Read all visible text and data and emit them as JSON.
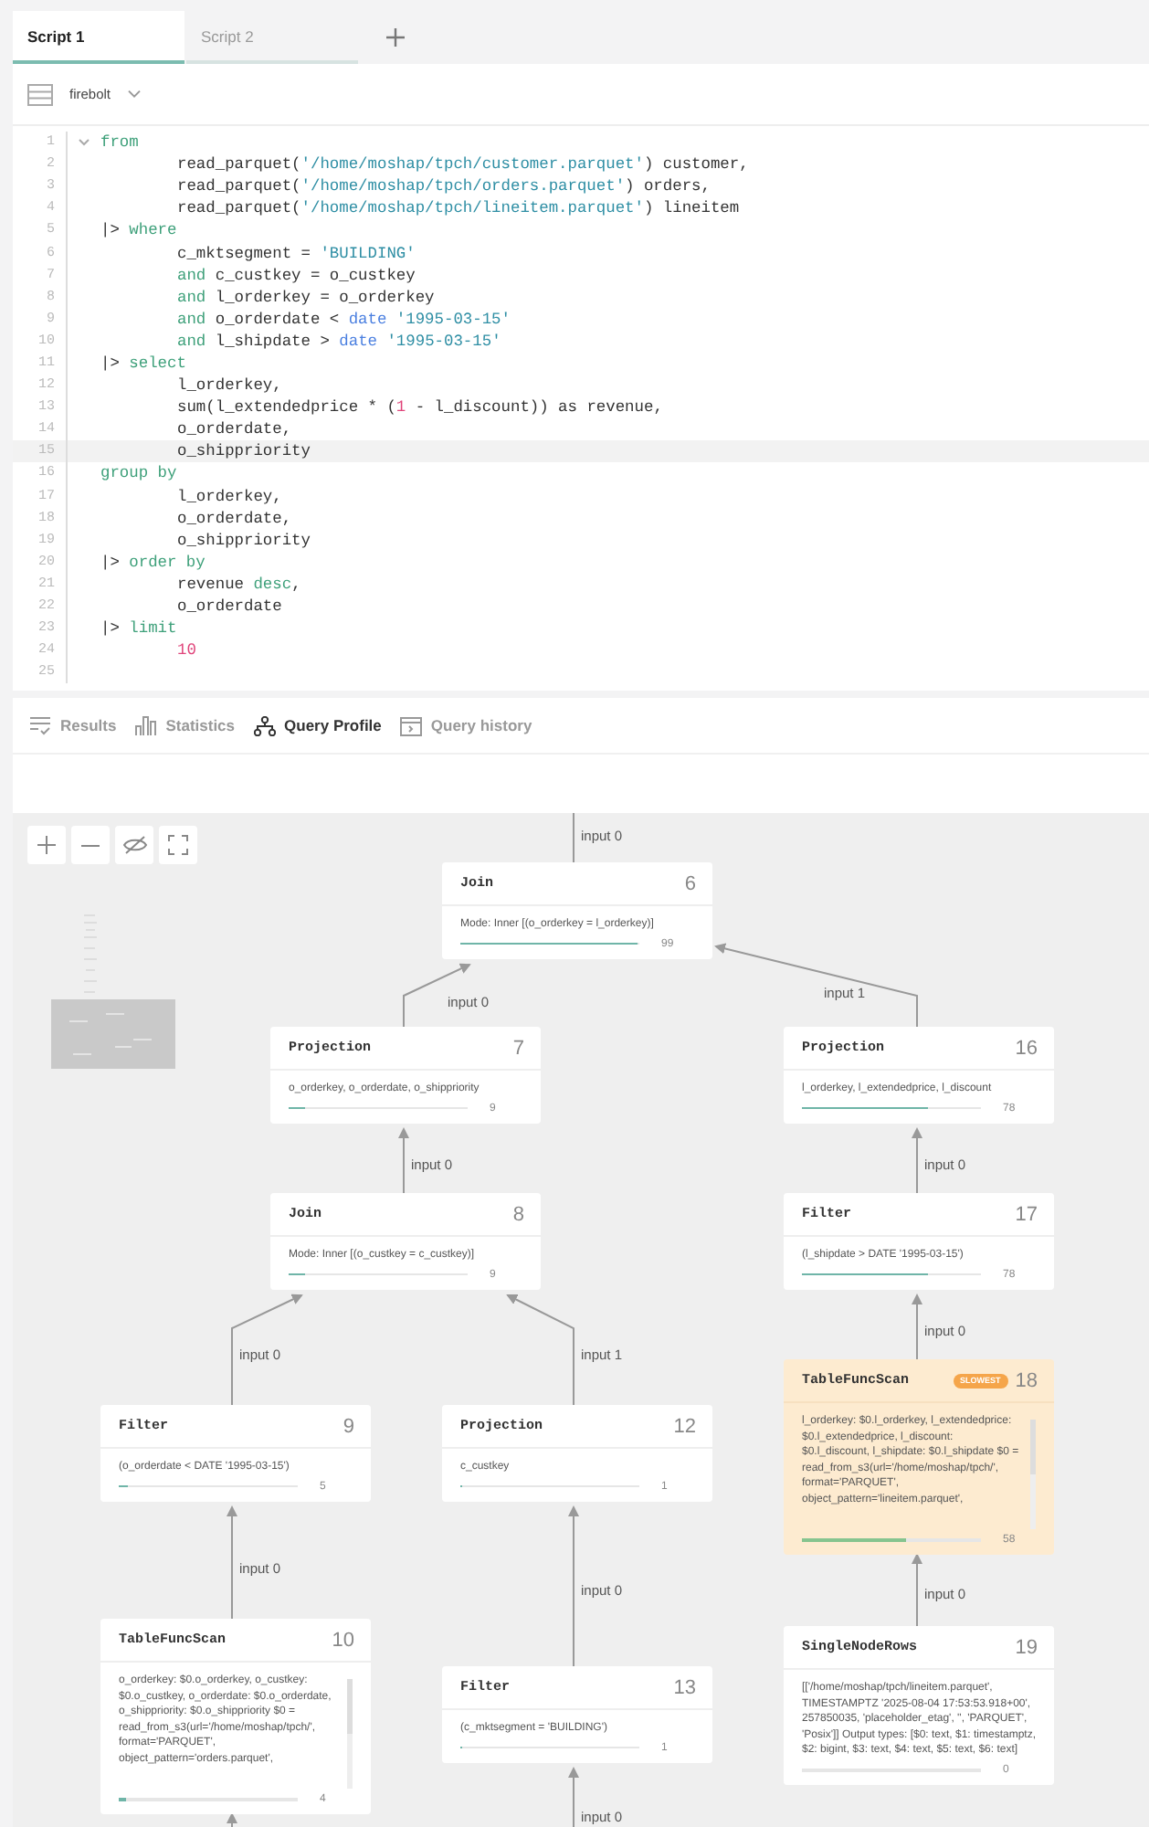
{
  "script_tabs": [
    {
      "label": "Script 1",
      "selected": true
    },
    {
      "label": "Script 2",
      "selected": false
    }
  ],
  "database": {
    "name": "firebolt"
  },
  "editor": {
    "lines": [
      {
        "number": "1",
        "indent": false,
        "highlighted": false,
        "tokens": [
          {
            "kind": "kw",
            "t": "from"
          }
        ]
      },
      {
        "number": "2",
        "indent": true,
        "highlighted": false,
        "tokens": [
          {
            "kind": "plain",
            "t": "read_parquet("
          },
          {
            "kind": "str",
            "t": "'/home/moshap/tpch/customer.parquet'"
          },
          {
            "kind": "plain",
            "t": ") customer,"
          }
        ]
      },
      {
        "number": "3",
        "indent": true,
        "highlighted": false,
        "tokens": [
          {
            "kind": "plain",
            "t": "read_parquet("
          },
          {
            "kind": "str",
            "t": "'/home/moshap/tpch/orders.parquet'"
          },
          {
            "kind": "plain",
            "t": ") orders,"
          }
        ]
      },
      {
        "number": "4",
        "indent": true,
        "highlighted": false,
        "tokens": [
          {
            "kind": "plain",
            "t": "read_parquet("
          },
          {
            "kind": "str",
            "t": "'/home/moshap/tpch/lineitem.parquet'"
          },
          {
            "kind": "plain",
            "t": ") lineitem"
          }
        ]
      },
      {
        "number": "5",
        "indent": false,
        "highlighted": false,
        "tokens": [
          {
            "kind": "plain",
            "t": "|> "
          },
          {
            "kind": "kw",
            "t": "where"
          }
        ]
      },
      {
        "number": "6",
        "indent": true,
        "highlighted": false,
        "tokens": [
          {
            "kind": "plain",
            "t": "c_mktsegment = "
          },
          {
            "kind": "str",
            "t": "'BUILDING'"
          }
        ]
      },
      {
        "number": "7",
        "indent": true,
        "highlighted": false,
        "tokens": [
          {
            "kind": "kw",
            "t": "and"
          },
          {
            "kind": "plain",
            "t": " c_custkey = o_custkey"
          }
        ]
      },
      {
        "number": "8",
        "indent": true,
        "highlighted": false,
        "tokens": [
          {
            "kind": "kw",
            "t": "and"
          },
          {
            "kind": "plain",
            "t": " l_orderkey = o_orderkey"
          }
        ]
      },
      {
        "number": "9",
        "indent": true,
        "highlighted": false,
        "tokens": [
          {
            "kind": "kw",
            "t": "and"
          },
          {
            "kind": "plain",
            "t": " o_orderdate < "
          },
          {
            "kind": "fn",
            "t": "date "
          },
          {
            "kind": "str",
            "t": "'1995-03-15'"
          }
        ]
      },
      {
        "number": "10",
        "indent": true,
        "highlighted": false,
        "tokens": [
          {
            "kind": "kw",
            "t": "and"
          },
          {
            "kind": "plain",
            "t": " l_shipdate > "
          },
          {
            "kind": "fn",
            "t": "date "
          },
          {
            "kind": "str",
            "t": "'1995-03-15'"
          }
        ]
      },
      {
        "number": "11",
        "indent": false,
        "highlighted": false,
        "tokens": [
          {
            "kind": "plain",
            "t": "|> "
          },
          {
            "kind": "kw",
            "t": "select"
          }
        ]
      },
      {
        "number": "12",
        "indent": true,
        "highlighted": false,
        "tokens": [
          {
            "kind": "plain",
            "t": "l_orderkey,"
          }
        ]
      },
      {
        "number": "13",
        "indent": true,
        "highlighted": false,
        "tokens": [
          {
            "kind": "plain",
            "t": "sum(l_extendedprice * ("
          },
          {
            "kind": "num",
            "t": "1"
          },
          {
            "kind": "plain",
            "t": " - l_discount)) as revenue,"
          }
        ]
      },
      {
        "number": "14",
        "indent": true,
        "highlighted": false,
        "tokens": [
          {
            "kind": "plain",
            "t": "o_orderdate,"
          }
        ]
      },
      {
        "number": "15",
        "indent": true,
        "highlighted": true,
        "tokens": [
          {
            "kind": "plain",
            "t": "o_shippriority"
          }
        ]
      },
      {
        "number": "16",
        "indent": false,
        "highlighted": false,
        "tokens": [
          {
            "kind": "kw",
            "t": "group by"
          }
        ]
      },
      {
        "number": "17",
        "indent": true,
        "highlighted": false,
        "tokens": [
          {
            "kind": "plain",
            "t": "l_orderkey,"
          }
        ]
      },
      {
        "number": "18",
        "indent": true,
        "highlighted": false,
        "tokens": [
          {
            "kind": "plain",
            "t": "o_orderdate,"
          }
        ]
      },
      {
        "number": "19",
        "indent": true,
        "highlighted": false,
        "tokens": [
          {
            "kind": "plain",
            "t": "o_shippriority"
          }
        ]
      },
      {
        "number": "20",
        "indent": false,
        "highlighted": false,
        "tokens": [
          {
            "kind": "plain",
            "t": "|> "
          },
          {
            "kind": "kw",
            "t": "order by"
          }
        ]
      },
      {
        "number": "21",
        "indent": true,
        "highlighted": false,
        "tokens": [
          {
            "kind": "plain",
            "t": "revenue "
          },
          {
            "kind": "kw",
            "t": "desc"
          },
          {
            "kind": "plain",
            "t": ","
          }
        ]
      },
      {
        "number": "22",
        "indent": true,
        "highlighted": false,
        "tokens": [
          {
            "kind": "plain",
            "t": "o_orderdate"
          }
        ]
      },
      {
        "number": "23",
        "indent": false,
        "highlighted": false,
        "tokens": [
          {
            "kind": "plain",
            "t": "|> "
          },
          {
            "kind": "kw",
            "t": "limit"
          }
        ]
      },
      {
        "number": "24",
        "indent": true,
        "highlighted": false,
        "tokens": [
          {
            "kind": "num",
            "t": "10"
          }
        ]
      },
      {
        "number": "25",
        "highlighted": false
      }
    ]
  },
  "result_tabs": [
    {
      "label": "Results",
      "kind": "results",
      "selected": false
    },
    {
      "label": "Statistics",
      "kind": "statistics",
      "selected": false
    },
    {
      "label": "Query Profile",
      "kind": "profile",
      "selected": true
    },
    {
      "label": "Query history",
      "kind": "history",
      "selected": false
    }
  ],
  "profile": {
    "nodes": [
      {
        "kind": "step",
        "title": "Join",
        "number": "6",
        "detail": "Mode: Inner [(o_orderkey = l_orderkey)]",
        "count": "99",
        "level": 0.99,
        "slowest": false
      },
      {
        "kind": "step",
        "title": "Projection",
        "number": "7",
        "detail": "o_orderkey, o_orderdate, o_shippriority",
        "count": "9",
        "level": 0.09,
        "slowest": false
      },
      {
        "kind": "step",
        "title": "Projection",
        "number": "16",
        "detail": "l_orderkey, l_extendedprice, l_discount",
        "count": "78",
        "level": 0.7,
        "slowest": false
      },
      {
        "kind": "step",
        "title": "Join",
        "number": "8",
        "detail": "Mode: Inner [(o_custkey = c_custkey)]",
        "count": "9",
        "level": 0.09,
        "slowest": false
      },
      {
        "kind": "step",
        "title": "Filter",
        "number": "17",
        "detail": "(l_shipdate > DATE '1995-03-15')",
        "count": "78",
        "level": 0.7,
        "slowest": false
      },
      {
        "kind": "step",
        "title": "Filter",
        "number": "9",
        "detail": "(o_orderdate < DATE '1995-03-15')",
        "count": "5",
        "level": 0.05,
        "slowest": false
      },
      {
        "kind": "step",
        "title": "Projection",
        "number": "12",
        "detail": "c_custkey",
        "count": "1",
        "level": 0.01,
        "slowest": false
      },
      {
        "kind": "scan",
        "title": "TableFuncScan",
        "number": "18",
        "badge": "SLOWEST",
        "detail": "l_orderkey: $0.l_orderkey, l_extendedprice: $0.l_extendedprice, l_discount: $0.l_discount, l_shipdate: $0.l_shipdate $0 = read_from_s3(url='/home/moshap/tpch/', format='PARQUET', object_pattern='lineitem.parquet',",
        "count": "58",
        "level": 0.58,
        "slowest": true
      },
      {
        "kind": "scan",
        "title": "TableFuncScan",
        "number": "10",
        "detail": "o_orderkey: $0.o_orderkey, o_custkey: $0.o_custkey, o_orderdate: $0.o_orderdate, o_shippriority: $0.o_shippriority $0 = read_from_s3(url='/home/moshap/tpch/', format='PARQUET', object_pattern='orders.parquet',",
        "count": "4",
        "level": 0.04,
        "slowest": false
      },
      {
        "kind": "step",
        "title": "Filter",
        "number": "13",
        "detail": "(c_mktsegment = 'BUILDING')",
        "count": "1",
        "level": 0.01,
        "slowest": false
      },
      {
        "kind": "step",
        "title": "SingleNodeRows",
        "number": "19",
        "detail": "[['/home/moshap/tpch/lineitem.parquet', TIMESTAMPTZ '2025-08-04 17:53:53.918+00', 257850035, 'placeholder_etag', '', 'PARQUET', 'Posix']] Output types: [$0: text, $1: timestamptz, $2: bigint, $3: text, $4: text, $5: text, $6: text]",
        "count": "0",
        "level": 0,
        "slowest": false
      }
    ],
    "edges": [
      {
        "label": "input 0"
      },
      {
        "label": "input 0"
      },
      {
        "label": "input 1"
      },
      {
        "label": "input 0"
      },
      {
        "label": "input 0"
      },
      {
        "label": "input 0"
      },
      {
        "label": "input 1"
      },
      {
        "label": "input 0"
      },
      {
        "label": "input 0"
      },
      {
        "label": "input 0"
      },
      {
        "label": "input 0"
      },
      {
        "label": "input 0"
      }
    ]
  }
}
